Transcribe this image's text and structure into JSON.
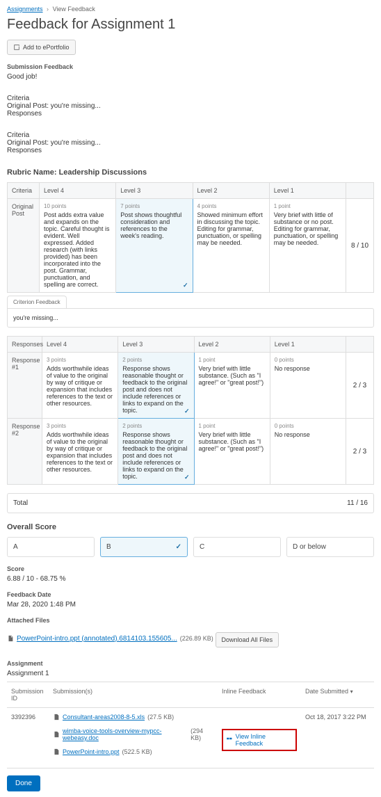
{
  "breadcrumb": {
    "parent": "Assignments",
    "current": "View Feedback"
  },
  "page_title": "Feedback for Assignment 1",
  "add_portfolio": "Add to ePortfolio",
  "submission_feedback_label": "Submission Feedback",
  "submission_feedback_text": "Good job!",
  "criteria_blocks": [
    {
      "title": "Criteria",
      "l1": "Original Post: you're missing...",
      "l2": "Responses"
    },
    {
      "title": "Criteria",
      "l1": "Original Post: you're missing...",
      "l2": "Responses"
    }
  ],
  "rubric_name": "Rubric Name: Leadership Discussions",
  "rubric1": {
    "headers": [
      "Criteria",
      "Level 4",
      "Level 3",
      "Level 2",
      "Level 1",
      ""
    ],
    "row_label": "Original Post",
    "cells": [
      {
        "pts": "10 points",
        "txt": "Post adds extra value and expands on the topic. Careful thought is evident. Well expressed. Added research (with links provided) has been incorporated into the post. Grammar, punctuation, and spelling are correct."
      },
      {
        "pts": "7 points",
        "txt": "Post shows thoughtful consideration and references to the week's reading.",
        "selected": true
      },
      {
        "pts": "4 points",
        "txt": "Showed minimum effort in discussing the topic. Editing for grammar, punctuation, or spelling may be needed."
      },
      {
        "pts": "1 point",
        "txt": "Very brief with little of substance or no post. Editing for grammar, punctuation, or spelling may be needed."
      }
    ],
    "score": "8 / 10"
  },
  "criterion_feedback_tab": "Criterion Feedback",
  "criterion_feedback_text": "you're missing...",
  "rubric2": {
    "headers": [
      "Responses",
      "Level 4",
      "Level 3",
      "Level 2",
      "Level 1",
      ""
    ],
    "rows": [
      {
        "label": "Response #1",
        "cells": [
          {
            "pts": "3 points",
            "txt": "Adds worthwhile ideas of value to the original by way of critique or expansion that includes references to the text or other resources."
          },
          {
            "pts": "2 points",
            "txt": "Response shows reasonable thought or feedback to the original post and does not include references or links to expand on the topic.",
            "selected": true
          },
          {
            "pts": "1 point",
            "txt": "Very brief with little substance. (Such as \"I agree!\" or \"great post!\")"
          },
          {
            "pts": "0 points",
            "txt": "No response"
          }
        ],
        "score": "2 / 3"
      },
      {
        "label": "Response #2",
        "cells": [
          {
            "pts": "3 points",
            "txt": "Adds worthwhile ideas of value to the original by way of critique or expansion that includes references to the text or other resources."
          },
          {
            "pts": "2 points",
            "txt": "Response shows reasonable thought or feedback to the original post and does not include references or links to expand on the topic.",
            "selected": true
          },
          {
            "pts": "1 point",
            "txt": "Very brief with little substance. (Such as \"I agree!\" or \"great post!\")"
          },
          {
            "pts": "0 points",
            "txt": "No response"
          }
        ],
        "score": "2 / 3"
      }
    ]
  },
  "total_label": "Total",
  "total_value": "11 / 16",
  "overall_score_label": "Overall Score",
  "grades": [
    {
      "label": "A",
      "selected": false
    },
    {
      "label": "B",
      "selected": true
    },
    {
      "label": "C",
      "selected": false
    },
    {
      "label": "D or below",
      "selected": false
    }
  ],
  "score_label": "Score",
  "score_value": "6.88 / 10 - 68.75 %",
  "feedback_date_label": "Feedback Date",
  "feedback_date_value": "Mar 28, 2020 1:48 PM",
  "attached_files_label": "Attached Files",
  "attached_file": {
    "name": "PowerPoint-intro.ppt (annotated).6814103.155605...",
    "size": "(226.89 KB)"
  },
  "download_all": "Download All Files",
  "assignment_label": "Assignment",
  "assignment_name": "Assignment 1",
  "subtable_headers": {
    "id": "Submission ID",
    "subs": "Submission(s)",
    "inline": "Inline Feedback",
    "date": "Date Submitted"
  },
  "submission_id": "3392396",
  "submissions": [
    {
      "name": "Consultant-areas2008-8-5.xls",
      "size": "(27.5 KB)",
      "inline": false
    },
    {
      "name": "wimba-voice-tools-overview-mypcc-webeasy.doc",
      "size": "(294 KB)",
      "inline": true
    },
    {
      "name": "PowerPoint-intro.ppt",
      "size": "(522.5 KB)",
      "inline": false
    }
  ],
  "view_inline": "View Inline Feedback",
  "date_submitted": "Oct 18, 2017 3:22 PM",
  "done": "Done"
}
